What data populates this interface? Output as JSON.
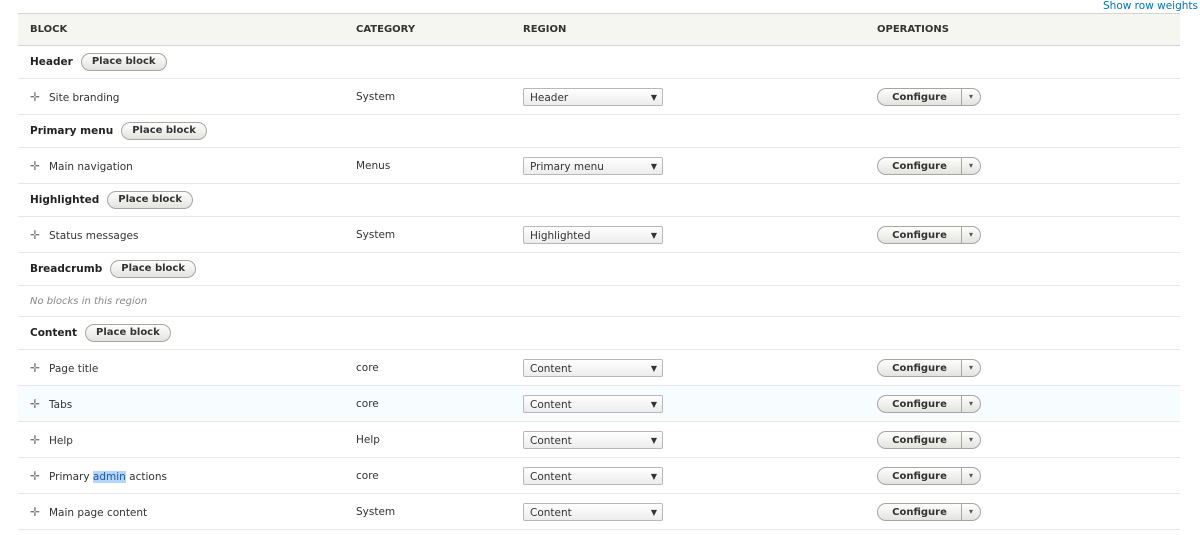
{
  "show_row_weights": "Show row weights",
  "columns": [
    "BLOCK",
    "CATEGORY",
    "REGION",
    "OPERATIONS"
  ],
  "place_block_label": "Place block",
  "configure_label": "Configure",
  "empty_message": "No blocks in this region",
  "regions": [
    {
      "title": "Header",
      "blocks": [
        {
          "name": "Site branding",
          "category": "System",
          "region": "Header"
        }
      ]
    },
    {
      "title": "Primary menu",
      "blocks": [
        {
          "name": "Main navigation",
          "category": "Menus",
          "region": "Primary menu"
        }
      ]
    },
    {
      "title": "Highlighted",
      "blocks": [
        {
          "name": "Status messages",
          "category": "System",
          "region": "Highlighted"
        }
      ]
    },
    {
      "title": "Breadcrumb",
      "blocks": []
    },
    {
      "title": "Content",
      "blocks": [
        {
          "name": "Page title",
          "category": "core",
          "region": "Content"
        },
        {
          "name": "Tabs",
          "category": "core",
          "region": "Content",
          "highlighted": true
        },
        {
          "name": "Help",
          "category": "Help",
          "region": "Content"
        },
        {
          "name": "Primary admin actions",
          "category": "core",
          "region": "Content",
          "selected_word": "admin"
        },
        {
          "name": "Main page content",
          "category": "System",
          "region": "Content"
        }
      ]
    }
  ]
}
